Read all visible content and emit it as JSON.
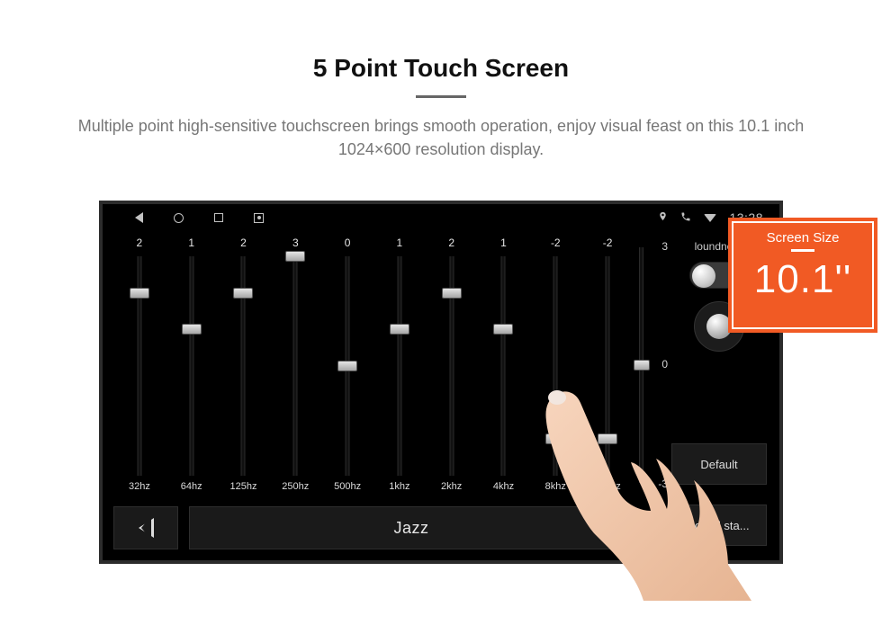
{
  "heading": "5 Point Touch Screen",
  "subtitle": "Multiple point high-sensitive touchscreen brings smooth operation, enjoy visual feast on this 10.1 inch 1024×600 resolution display.",
  "statusbar": {
    "time": "13:28"
  },
  "callout": {
    "label": "Screen Size",
    "value": "10.1''"
  },
  "eq": {
    "range_min": -3,
    "range_max": 3,
    "bands": [
      {
        "freq": "32hz",
        "value": 2
      },
      {
        "freq": "64hz",
        "value": 1
      },
      {
        "freq": "125hz",
        "value": 2
      },
      {
        "freq": "250hz",
        "value": 3
      },
      {
        "freq": "500hz",
        "value": 0
      },
      {
        "freq": "1khz",
        "value": 1
      },
      {
        "freq": "2khz",
        "value": 2
      },
      {
        "freq": "4khz",
        "value": 1
      },
      {
        "freq": "8khz",
        "value": -2
      },
      {
        "freq": "16khz",
        "value": -2
      }
    ],
    "scale_ticks": [
      3,
      0,
      -3
    ],
    "master_value": 0
  },
  "rightcol": {
    "loudness_label": "loundness",
    "loudness_on": false,
    "default_label": "Default",
    "sound_label": "sound sta..."
  },
  "bottom": {
    "preset": "Jazz"
  }
}
